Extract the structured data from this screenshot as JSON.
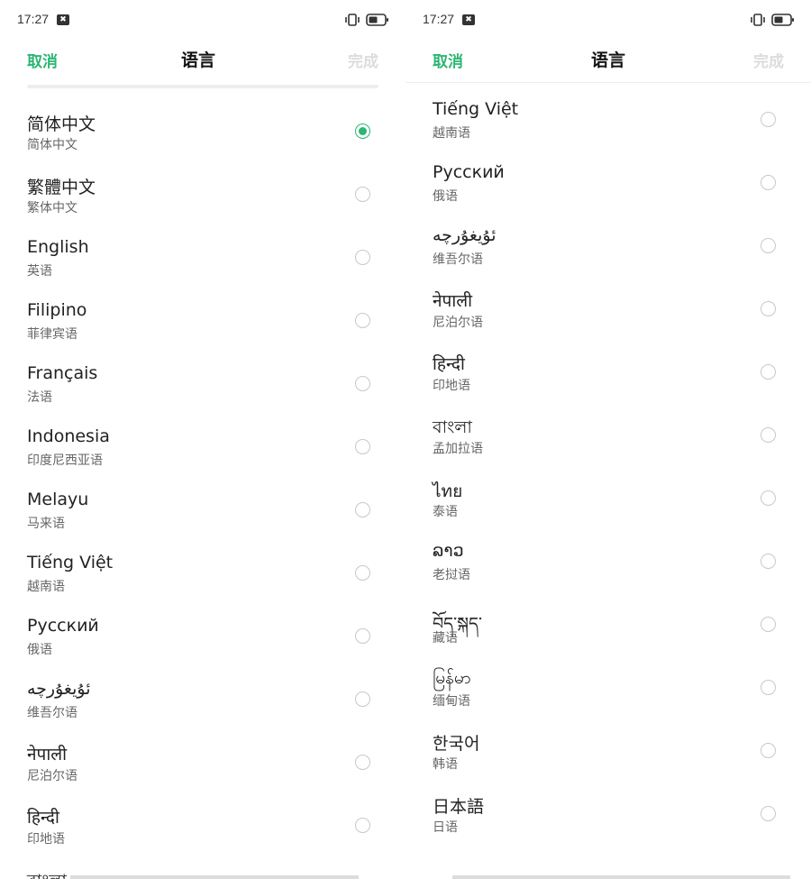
{
  "status": {
    "time": "17:27",
    "notif_glyph": "✖"
  },
  "header": {
    "cancel": "取消",
    "title": "语言",
    "done": "完成"
  },
  "colors": {
    "accent": "#2bb673",
    "disabled": "#dcdcdc",
    "radio": "#c8c8c8"
  },
  "left_languages": [
    {
      "name": "简体中文",
      "sub": "简体中文",
      "selected": true
    },
    {
      "name": "繁體中文",
      "sub": "繁体中文",
      "selected": false
    },
    {
      "name": "English",
      "sub": "英语",
      "selected": false
    },
    {
      "name": "Filipino",
      "sub": "菲律宾语",
      "selected": false
    },
    {
      "name": "Français",
      "sub": "法语",
      "selected": false
    },
    {
      "name": "Indonesia",
      "sub": "印度尼西亚语",
      "selected": false
    },
    {
      "name": "Melayu",
      "sub": "马来语",
      "selected": false
    },
    {
      "name": "Tiếng Việt",
      "sub": "越南语",
      "selected": false
    },
    {
      "name": "Русский",
      "sub": "俄语",
      "selected": false
    },
    {
      "name": "ئۇيغۇرچە",
      "sub": "维吾尔语",
      "selected": false
    },
    {
      "name": "नेपाली",
      "sub": "尼泊尔语",
      "selected": false
    },
    {
      "name": "हिन्दी",
      "sub": "印地语",
      "selected": false
    },
    {
      "name": "বাংলা",
      "sub": "",
      "selected": false
    }
  ],
  "right_languages": [
    {
      "name": "Tiếng Việt",
      "sub": "越南语",
      "selected": false
    },
    {
      "name": "Русский",
      "sub": "俄语",
      "selected": false
    },
    {
      "name": "ئۇيغۇرچە",
      "sub": "维吾尔语",
      "selected": false
    },
    {
      "name": "नेपाली",
      "sub": "尼泊尔语",
      "selected": false
    },
    {
      "name": "हिन्दी",
      "sub": "印地语",
      "selected": false
    },
    {
      "name": "বাংলা",
      "sub": "孟加拉语",
      "selected": false
    },
    {
      "name": "ไทย",
      "sub": "泰语",
      "selected": false
    },
    {
      "name": "ລາວ",
      "sub": "老挝语",
      "selected": false
    },
    {
      "name": "བོད་སྐད་",
      "sub": "藏语",
      "selected": false
    },
    {
      "name": "မြန်မာ",
      "sub": "缅甸语",
      "selected": false
    },
    {
      "name": "한국어",
      "sub": "韩语",
      "selected": false
    },
    {
      "name": "日本語",
      "sub": "日语",
      "selected": false
    }
  ]
}
